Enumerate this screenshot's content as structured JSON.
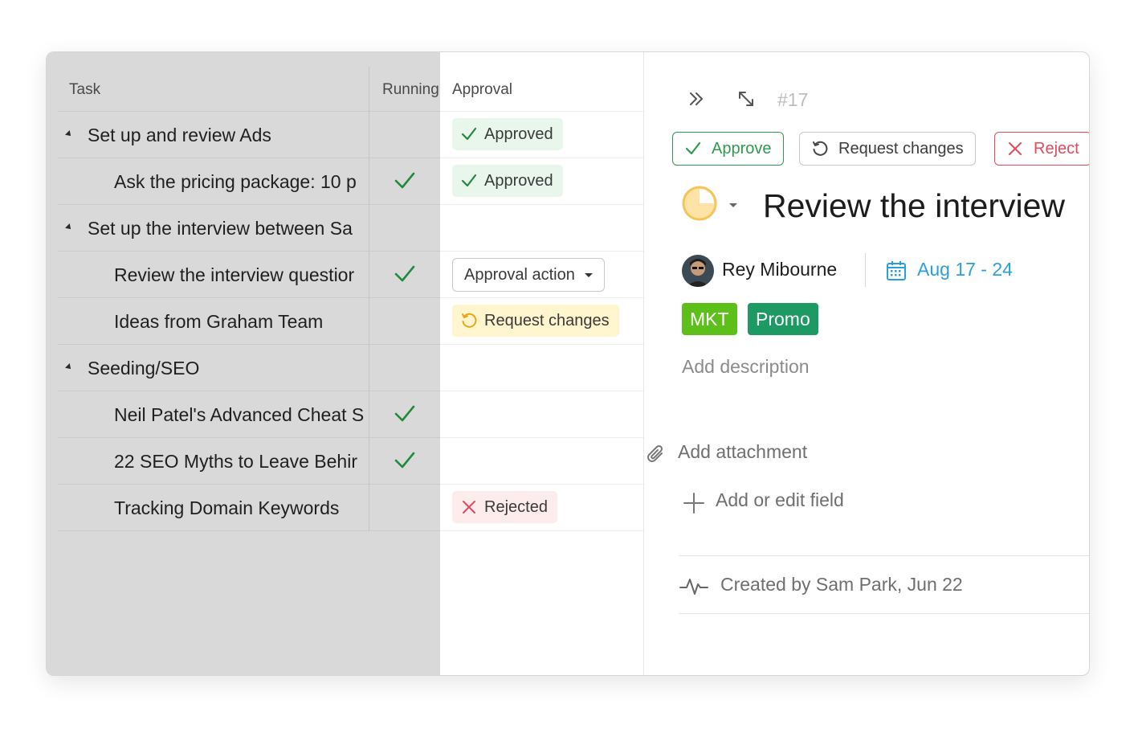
{
  "columns": {
    "task": "Task",
    "running": "Running",
    "approval": "Approval"
  },
  "rows": [
    {
      "label": "Set up and review Ads",
      "group": true,
      "checked": false,
      "approval": "approved"
    },
    {
      "label": "Ask the pricing package: 10 p",
      "group": false,
      "checked": true,
      "approval": "approved"
    },
    {
      "label": "Set up the interview between Sa",
      "group": true,
      "checked": false,
      "approval": ""
    },
    {
      "label": "Review the interview questior",
      "group": false,
      "checked": true,
      "approval": "action"
    },
    {
      "label": "Ideas from Graham Team",
      "group": false,
      "checked": false,
      "approval": "changes"
    },
    {
      "label": "Seeding/SEO",
      "group": true,
      "checked": false,
      "approval": ""
    },
    {
      "label": "Neil Patel's Advanced Cheat S",
      "group": false,
      "checked": true,
      "approval": ""
    },
    {
      "label": "22 SEO Myths to Leave Behir",
      "group": false,
      "checked": true,
      "approval": ""
    },
    {
      "label": "Tracking Domain Keywords",
      "group": false,
      "checked": false,
      "approval": "rejected"
    }
  ],
  "approval_labels": {
    "approved": "Approved",
    "changes": "Request changes",
    "rejected": "Rejected",
    "action": "Approval action"
  },
  "detail": {
    "task_id": "#17",
    "approve_label": "Approve",
    "request_changes_label": "Request changes",
    "reject_label": "Reject",
    "title": "Review the interview",
    "assignee": "Rey Mibourne",
    "date_range": "Aug 17 - 24",
    "tags": [
      "MKT",
      "Promo"
    ],
    "add_description": "Add description",
    "add_attachment": "Add attachment",
    "add_field": "Add or edit field",
    "created": "Created by Sam Park, Jun 22"
  },
  "colors": {
    "approve": "#2e9a51",
    "reject": "#e24b5b",
    "date": "#2aa0d8",
    "tag_mkt": "#5cbf1a",
    "tag_promo": "#1d9a63",
    "status": "#f5c55a"
  }
}
